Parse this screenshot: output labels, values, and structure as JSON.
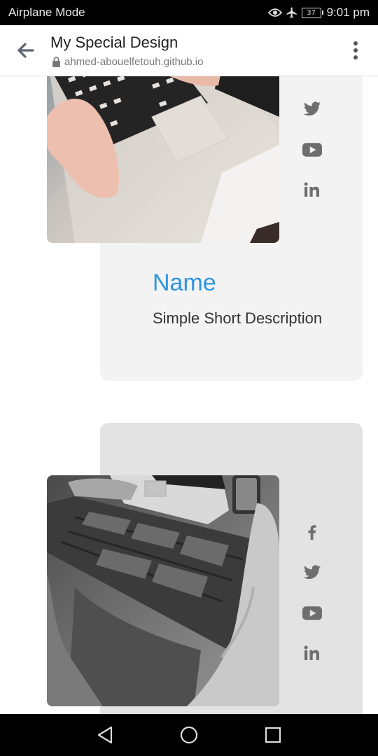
{
  "status_bar": {
    "mode_text": "Airplane Mode",
    "battery_level": "37",
    "time": "9:01 pm"
  },
  "browser": {
    "page_title": "My Special Design",
    "url": "ahmed-abouelfetouh.github.io"
  },
  "cards": [
    {
      "name": "Name",
      "description": "Simple Short Description",
      "image": "laptop-typing-photo",
      "social_icons": [
        "twitter-icon",
        "youtube-icon",
        "linkedin-icon"
      ]
    },
    {
      "image": "laptop-on-lap-grayscale-photo",
      "social_icons": [
        "facebook-icon",
        "twitter-icon",
        "youtube-icon",
        "linkedin-icon"
      ]
    }
  ],
  "colors": {
    "accent": "#2d95de",
    "card1_bg": "#f3f3f3",
    "card2_bg": "#e3e3e3",
    "icon_gray": "#6e6e6e"
  }
}
